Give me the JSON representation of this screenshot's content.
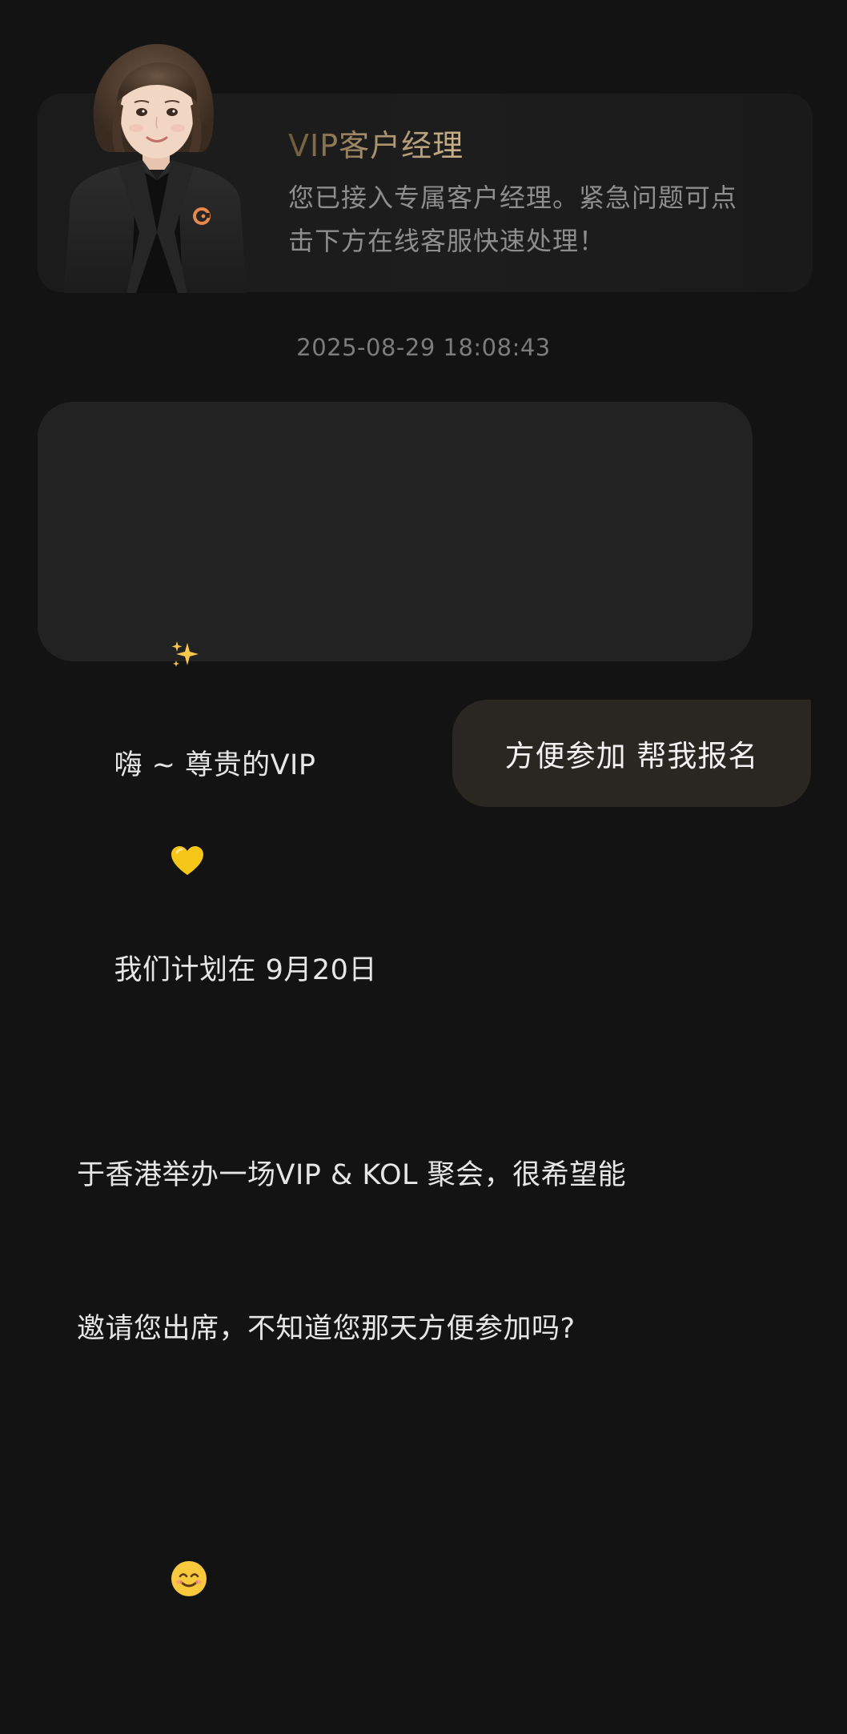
{
  "manager": {
    "title": "VIP客户经理",
    "desc_line1": "您已接入专属客户经理。紧急问题可点",
    "desc_line2": "击下方在线客服快速处理！",
    "avatar_icon": "customer-manager-avatar"
  },
  "timestamp": "2025-08-29 18:08:43",
  "incoming": {
    "line1_a": "嗨 ~ 尊贵的VIP",
    "line1_b": "我们计划在 9月20日",
    "line2": "于香港举办一场VIP & KOL 聚会，很希望能",
    "line3": "邀请您出席，不知道您那天方便参加吗?",
    "icons": [
      "sparkles-icon",
      "yellow-heart-icon",
      "smiling-face-icon"
    ]
  },
  "outgoing": {
    "text": "方便参加  帮我报名"
  },
  "colors": {
    "background": "#131313",
    "card": "#1c1c1c",
    "bubble_in": "#222222",
    "bubble_out": "#2a2621",
    "gold": "#a68f6a",
    "heart": "#f5c518",
    "badge_orange": "#e8884a"
  }
}
